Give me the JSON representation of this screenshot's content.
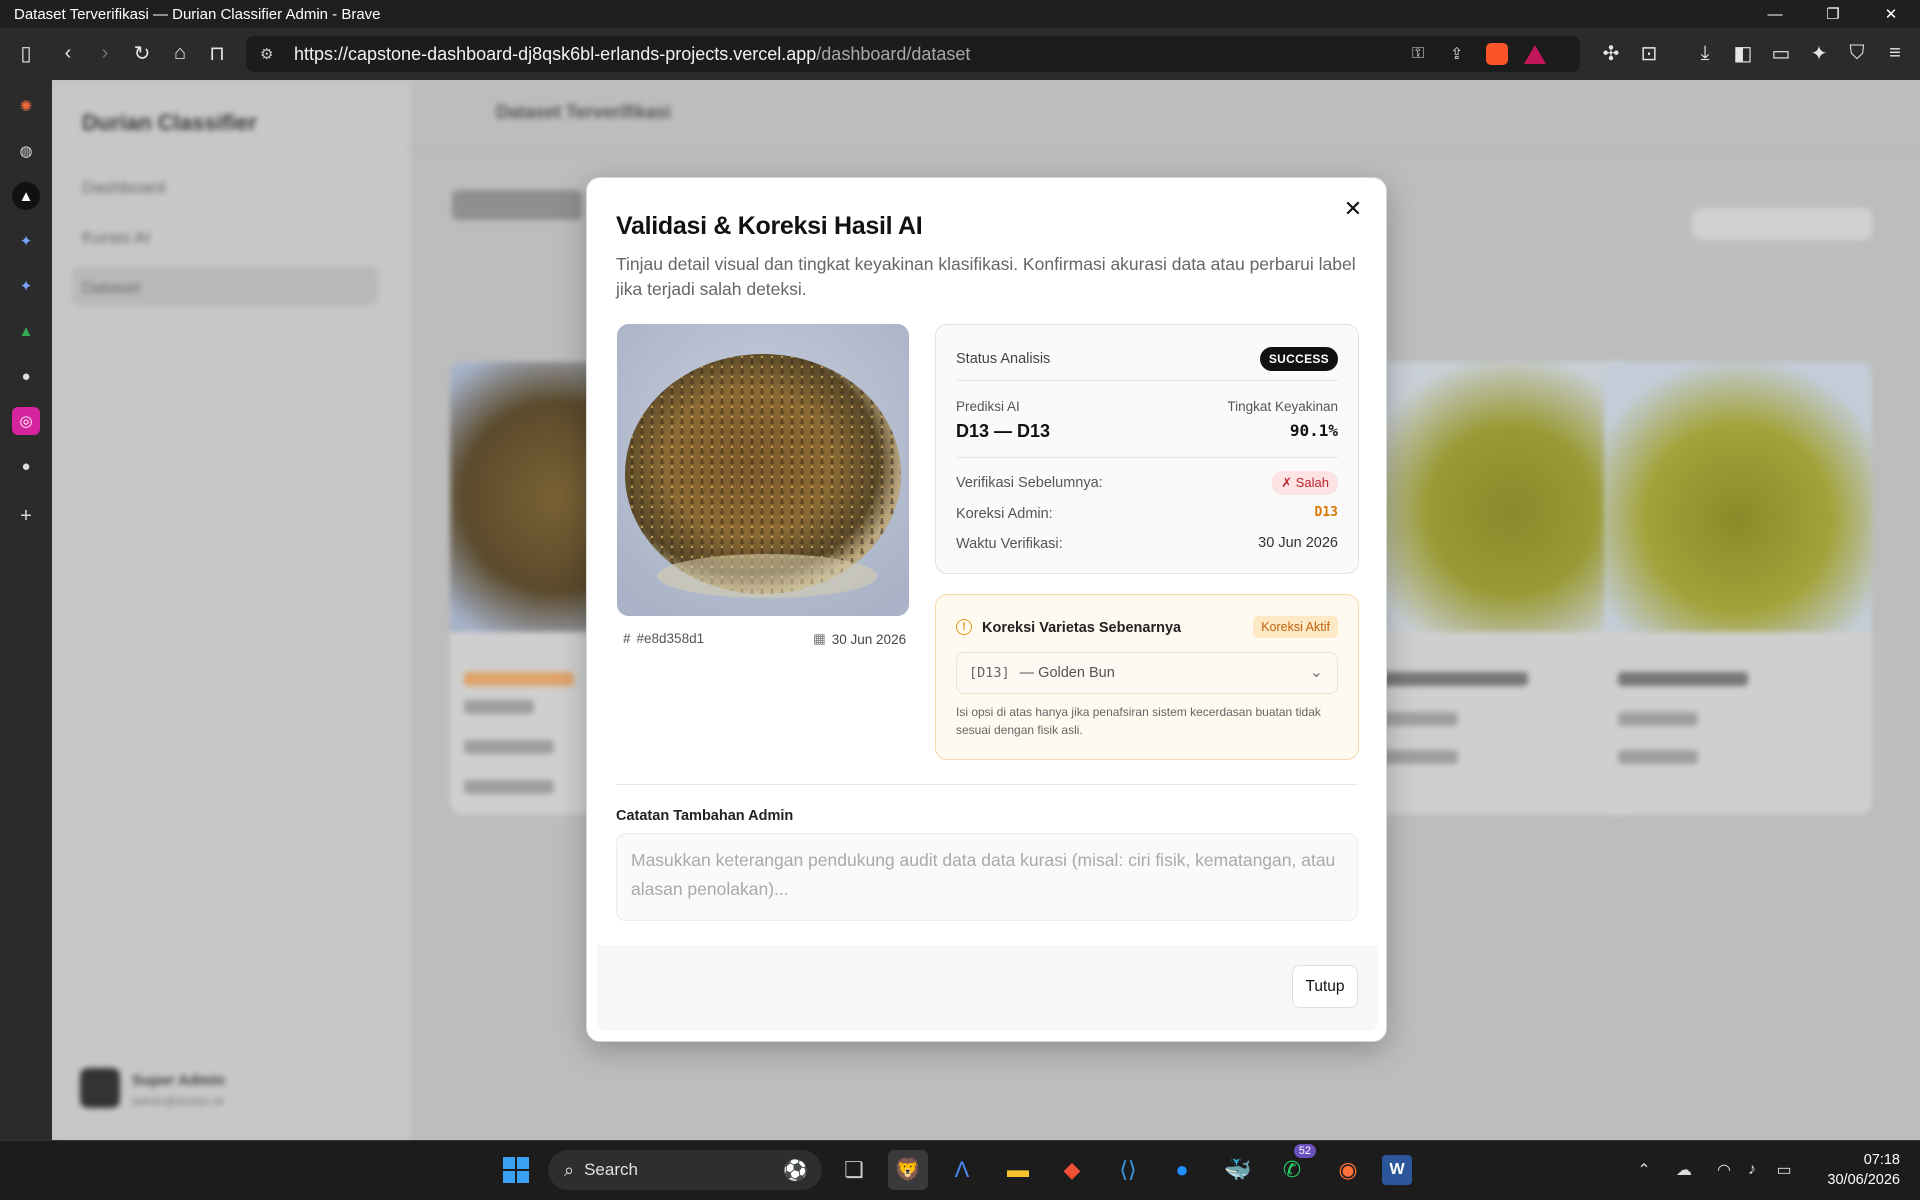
{
  "window": {
    "title": "Dataset Terverifikasi — Durian Classifier Admin - Brave"
  },
  "browser": {
    "url_host": "https://capstone-dashboard-dj8qsk6bl-erlands-projects.vercel.app",
    "url_path": "/dashboard/dataset"
  },
  "background_page": {
    "brand": "Durian Classifier",
    "nav": [
      "Dashboard",
      "Kurasi AI",
      "Dataset"
    ],
    "header_title": "Dataset Terverifikasi",
    "user_name": "Super Admin",
    "user_email": "admin@durian.id"
  },
  "modal": {
    "title": "Validasi & Koreksi Hasil AI",
    "description": "Tinjau detail visual dan tingkat keyakinan klasifikasi. Konfirmasi akurasi data atau perbarui label jika terjadi salah deteksi.",
    "image_id": "#e8d358d1",
    "image_date": "30 Jun 2026",
    "status": {
      "label": "Status Analisis",
      "badge": "SUCCESS",
      "prediction_label": "Prediksi AI",
      "prediction_value": "D13 — D13",
      "confidence_label": "Tingkat Keyakinan",
      "confidence_value": "90.1%",
      "prev_verification_label": "Verifikasi Sebelumnya:",
      "prev_verification_badge": "✗ Salah",
      "admin_correction_label": "Koreksi Admin:",
      "admin_correction_value": "D13",
      "verification_time_label": "Waktu Verifikasi:",
      "verification_time_value": "30 Jun 2026"
    },
    "correction": {
      "title": "Koreksi Varietas Sebenarnya",
      "badge": "Koreksi Aktif",
      "selected_code": "[D13]",
      "selected_name": "— Golden Bun",
      "hint": "Isi opsi di atas hanya jika penafsiran sistem kecerdasan buatan tidak sesuai dengan fisik asli."
    },
    "notes": {
      "label": "Catatan Tambahan Admin",
      "placeholder": "Masukkan keterangan pendukung audit data data kurasi (misal: ciri fisik, kematangan, atau alasan penolakan)...",
      "value": ""
    },
    "close_button": "Tutup"
  },
  "taskbar": {
    "search_label": "Search",
    "whatsapp_badge": "52",
    "time": "07:18",
    "date": "30/06/2026"
  },
  "colors": {
    "accent_orange": "#d97706",
    "success_badge": "#111111",
    "error_red": "#c0262d"
  }
}
